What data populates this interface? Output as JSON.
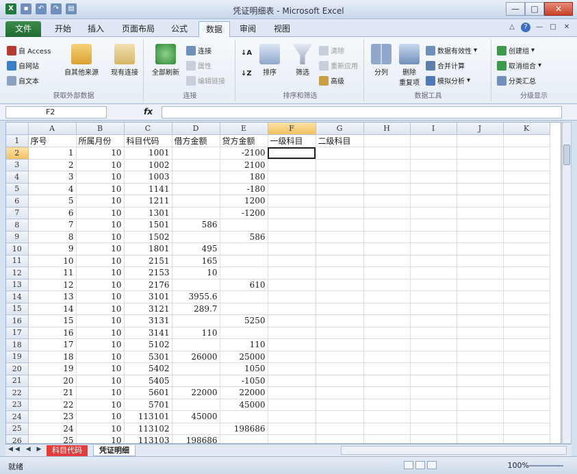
{
  "window": {
    "title": "凭证明细表 - Microsoft Excel",
    "min": "—",
    "max": "□",
    "close": "✕"
  },
  "qat": {
    "logo": "X"
  },
  "tabs": [
    "文件",
    "开始",
    "插入",
    "页面布局",
    "公式",
    "数据",
    "审阅",
    "视图"
  ],
  "active_tab": "数据",
  "ribbon": {
    "get_external": {
      "access": "自 Access",
      "web": "自网站",
      "text": "自文本",
      "other": "自其他来源",
      "existing": "现有连接",
      "label": "获取外部数据"
    },
    "connections": {
      "refresh": "全部刷新",
      "connections": "连接",
      "properties": "属性",
      "edit_links": "编辑链接",
      "label": "连接"
    },
    "sort_filter": {
      "sort": "排序",
      "filter": "筛选",
      "clear": "清除",
      "reapply": "重新应用",
      "advanced": "高级",
      "label": "排序和筛选"
    },
    "data_tools": {
      "split": "分列",
      "remove_dup": "删除\n重复项",
      "validation": "数据有效性",
      "consolidate": "合并计算",
      "whatif": "模拟分析",
      "label": "数据工具"
    },
    "outline": {
      "group": "创建组",
      "ungroup": "取消组合",
      "subtotal": "分类汇总",
      "label": "分级显示"
    }
  },
  "formula_bar": {
    "name_box": "F2",
    "fx": "fx",
    "value": ""
  },
  "columns": [
    "A",
    "B",
    "C",
    "D",
    "E",
    "F",
    "G",
    "H",
    "I",
    "J",
    "K"
  ],
  "selected_column": "F",
  "selected_row": "2",
  "rows": [
    {
      "n": "1",
      "c": [
        "序号",
        "所属月份",
        "科目代码",
        "借方金额",
        "贷方金额",
        "一级科目",
        "二级科目",
        "",
        "",
        "",
        ""
      ]
    },
    {
      "n": "2",
      "c": [
        "1",
        "10",
        "1001",
        "",
        "-2100",
        "",
        "",
        "",
        "",
        "",
        ""
      ]
    },
    {
      "n": "3",
      "c": [
        "2",
        "10",
        "1002",
        "",
        "2100",
        "",
        "",
        "",
        "",
        "",
        ""
      ]
    },
    {
      "n": "4",
      "c": [
        "3",
        "10",
        "1003",
        "",
        "180",
        "",
        "",
        "",
        "",
        "",
        ""
      ]
    },
    {
      "n": "5",
      "c": [
        "4",
        "10",
        "1141",
        "",
        "-180",
        "",
        "",
        "",
        "",
        "",
        ""
      ]
    },
    {
      "n": "6",
      "c": [
        "5",
        "10",
        "1211",
        "",
        "1200",
        "",
        "",
        "",
        "",
        "",
        ""
      ]
    },
    {
      "n": "7",
      "c": [
        "6",
        "10",
        "1301",
        "",
        "-1200",
        "",
        "",
        "",
        "",
        "",
        ""
      ]
    },
    {
      "n": "8",
      "c": [
        "7",
        "10",
        "1501",
        "586",
        "",
        "",
        "",
        "",
        "",
        "",
        ""
      ]
    },
    {
      "n": "9",
      "c": [
        "8",
        "10",
        "1502",
        "",
        "586",
        "",
        "",
        "",
        "",
        "",
        ""
      ]
    },
    {
      "n": "10",
      "c": [
        "9",
        "10",
        "1801",
        "495",
        "",
        "",
        "",
        "",
        "",
        "",
        ""
      ]
    },
    {
      "n": "11",
      "c": [
        "10",
        "10",
        "2151",
        "165",
        "",
        "",
        "",
        "",
        "",
        "",
        ""
      ]
    },
    {
      "n": "12",
      "c": [
        "11",
        "10",
        "2153",
        "10",
        "",
        "",
        "",
        "",
        "",
        "",
        ""
      ]
    },
    {
      "n": "13",
      "c": [
        "12",
        "10",
        "2176",
        "",
        "610",
        "",
        "",
        "",
        "",
        "",
        ""
      ]
    },
    {
      "n": "14",
      "c": [
        "13",
        "10",
        "3101",
        "3955.6",
        "",
        "",
        "",
        "",
        "",
        "",
        ""
      ]
    },
    {
      "n": "15",
      "c": [
        "14",
        "10",
        "3121",
        "289.7",
        "",
        "",
        "",
        "",
        "",
        "",
        ""
      ]
    },
    {
      "n": "16",
      "c": [
        "15",
        "10",
        "3131",
        "",
        "5250",
        "",
        "",
        "",
        "",
        "",
        ""
      ]
    },
    {
      "n": "17",
      "c": [
        "16",
        "10",
        "3141",
        "110",
        "",
        "",
        "",
        "",
        "",
        "",
        ""
      ]
    },
    {
      "n": "18",
      "c": [
        "17",
        "10",
        "5102",
        "",
        "110",
        "",
        "",
        "",
        "",
        "",
        ""
      ]
    },
    {
      "n": "19",
      "c": [
        "18",
        "10",
        "5301",
        "26000",
        "25000",
        "",
        "",
        "",
        "",
        "",
        ""
      ]
    },
    {
      "n": "20",
      "c": [
        "19",
        "10",
        "5402",
        "",
        "1050",
        "",
        "",
        "",
        "",
        "",
        ""
      ]
    },
    {
      "n": "21",
      "c": [
        "20",
        "10",
        "5405",
        "",
        "-1050",
        "",
        "",
        "",
        "",
        "",
        ""
      ]
    },
    {
      "n": "22",
      "c": [
        "21",
        "10",
        "5601",
        "22000",
        "22000",
        "",
        "",
        "",
        "",
        "",
        ""
      ]
    },
    {
      "n": "23",
      "c": [
        "22",
        "10",
        "5701",
        "",
        "45000",
        "",
        "",
        "",
        "",
        "",
        ""
      ]
    },
    {
      "n": "24",
      "c": [
        "23",
        "10",
        "113101",
        "45000",
        "",
        "",
        "",
        "",
        "",
        "",
        ""
      ]
    },
    {
      "n": "25",
      "c": [
        "24",
        "10",
        "113102",
        "",
        "198686",
        "",
        "",
        "",
        "",
        "",
        ""
      ]
    },
    {
      "n": "26",
      "c": [
        "25",
        "10",
        "113103",
        "198686",
        "",
        "",
        "",
        "",
        "",
        "",
        ""
      ]
    }
  ],
  "sheet_tabs": {
    "first": "科目代码",
    "second": "凭证明细"
  },
  "status": {
    "ready": "就绪",
    "zoom": "100%"
  },
  "colors": {
    "file_tab": "#1f6c33",
    "selected_header": "#f1c15f",
    "red_tab": "#e43b3b"
  }
}
